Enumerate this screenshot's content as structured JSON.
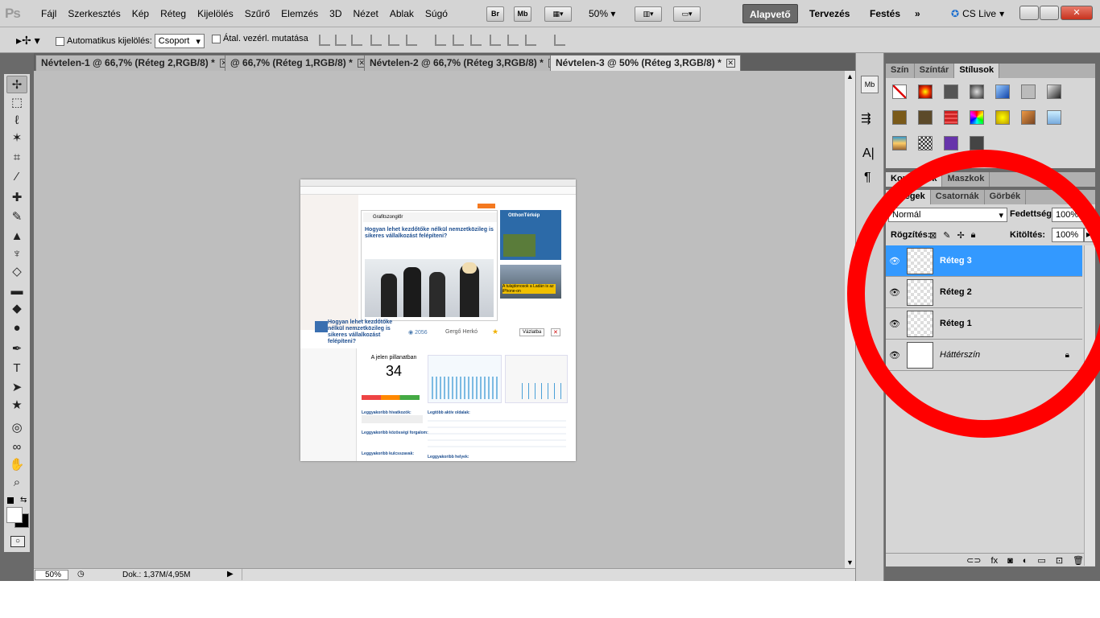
{
  "app": {
    "logo": "Ps"
  },
  "menu": [
    "Fájl",
    "Szerkesztés",
    "Kép",
    "Réteg",
    "Kijelölés",
    "Szűrő",
    "Elemzés",
    "3D",
    "Nézet",
    "Ablak",
    "Súgó"
  ],
  "appbar": {
    "br": "Br",
    "mb": "Mb",
    "zoom": "50%"
  },
  "workspaces": {
    "active": "Alapvető",
    "design": "Tervezés",
    "paint": "Festés",
    "more": "»",
    "cslive": "CS Live"
  },
  "options": {
    "auto_select_label": "Automatikus kijelölés:",
    "auto_select_value": "Csoport",
    "show_transform_label": "Átal. vezérl. mutatása"
  },
  "tabs": [
    {
      "label": "Névtelen-1 @ 66,7% (Réteg 2,RGB/8) *"
    },
    {
      "label": "@ 66,7% (Réteg 1,RGB/8) *"
    },
    {
      "label": "Névtelen-2 @ 66,7% (Réteg 3,RGB/8) *"
    },
    {
      "label": "Névtelen-3 @ 50% (Réteg 3,RGB/8) *"
    }
  ],
  "status": {
    "zoom": "50%",
    "doc": "Dok.: 1,37M/4,95M"
  },
  "swatch_panel": {
    "tabs": [
      "Szín",
      "Színtár",
      "Stílusok"
    ]
  },
  "adjust_panel": {
    "tabs": [
      "Korrekciók",
      "Maszkok"
    ]
  },
  "layers_panel": {
    "tabs": [
      "Rétegek",
      "Csatornák",
      "Görbék"
    ],
    "blend_mode": "Normál",
    "opacity_label": "Fedettség:",
    "opacity": "100%",
    "lock_label": "Rögzítés:",
    "fill_label": "Kitöltés:",
    "fill": "100%",
    "layers": [
      {
        "name": "Réteg 3",
        "active": true
      },
      {
        "name": "Réteg 2",
        "active": false
      },
      {
        "name": "Réteg 1",
        "active": false
      },
      {
        "name": "Háttérszín",
        "active": false
      }
    ]
  },
  "document": {
    "site_name": "Grafitszonglőr",
    "headline": "Hogyan lehet kezdőtőke nélkül nemzetközileg is sikeres vállalkozást felépíteni?",
    "headline_short": "Hogyan lehet kezdőtőke nélkül nemzetközileg is sikeres vállalkozást felépíteni?",
    "views": "2056",
    "author": "Gergő Herkó",
    "save_label": "Vázlatba",
    "now_label": "A jelen pillanatban",
    "now_value": "34",
    "top_sources_label": "Leggyakoribb hivatkozók:",
    "top_pages_label": "Legtöbb aktív oldalak:",
    "keywords_label": "Leggyakoribb kulcsszavak:",
    "places_label": "Leggyakoribb helyek:",
    "social_label": "Leggyakoribb közösségi forgalom:",
    "ad_brand": "OtthonTérkép",
    "ad_caption": "A tulajdonosok a Ladán is az iPhone-on"
  },
  "colors": {
    "accent": "#3399ff",
    "highlight": "#ff0000"
  }
}
